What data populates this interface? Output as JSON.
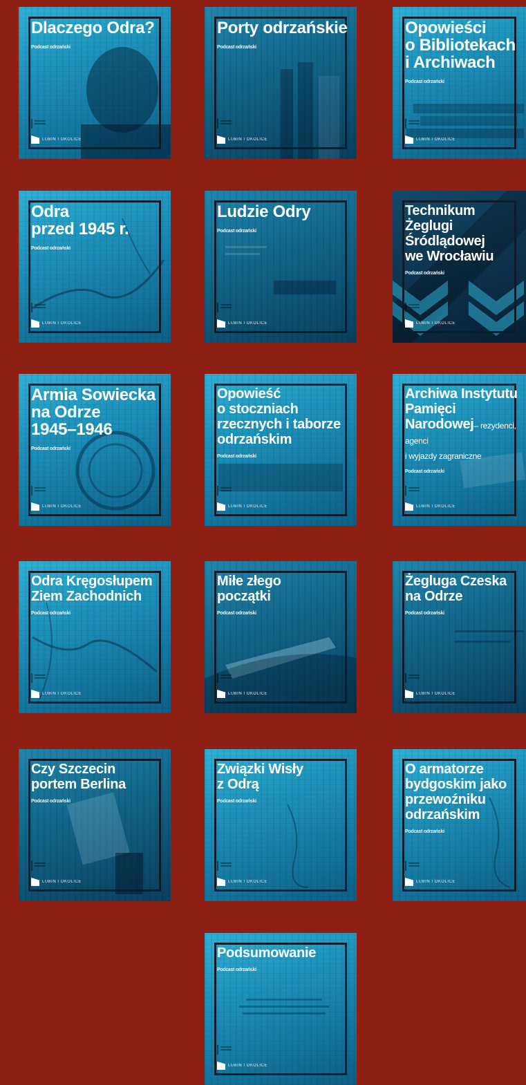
{
  "podcast_label": "Podcast odrzański",
  "brand_label": "LUBIN I OKOLICE",
  "tiles": [
    {
      "title": "Dlaczego Odra?",
      "subtitle": ""
    },
    {
      "title": "Porty odrzańskie",
      "subtitle": ""
    },
    {
      "title": "Opowieści\no Bibliotekach\ni Archiwach",
      "subtitle": ""
    },
    {
      "title": "Odra\nprzed 1945 r.",
      "subtitle": ""
    },
    {
      "title": "Ludzie Odry",
      "subtitle": ""
    },
    {
      "title": "Technikum Żeglugi\nŚródlądowej\nwe Wrocławiu",
      "subtitle": ""
    },
    {
      "title": "Armia Sowiecka\nna Odrze\n1945–1946",
      "subtitle": ""
    },
    {
      "title": "Opowieść\no stoczniach\nrzecznych i taborze\nodrzańskim",
      "subtitle": ""
    },
    {
      "title": "Archiwa Instytutu\nPamięci Narodowej",
      "subtitle": "– rezydenci, agenci\ni wyjazdy zagraniczne"
    },
    {
      "title": "Odra Kręgosłupem\nZiem Zachodnich",
      "subtitle": ""
    },
    {
      "title": "Miłe złego\npoczątki",
      "subtitle": ""
    },
    {
      "title": "Żegluga Czeska\nna Odrze",
      "subtitle": ""
    },
    {
      "title": "Czy Szczecin\nportem Berlina",
      "subtitle": ""
    },
    {
      "title": "Związki Wisły\nz Odrą",
      "subtitle": ""
    },
    {
      "title": "O armatorze\nbydgoskim jako\nprzewoźniku\nodrzańskim",
      "subtitle": ""
    },
    {
      "title": "Podsumowanie",
      "subtitle": ""
    }
  ]
}
